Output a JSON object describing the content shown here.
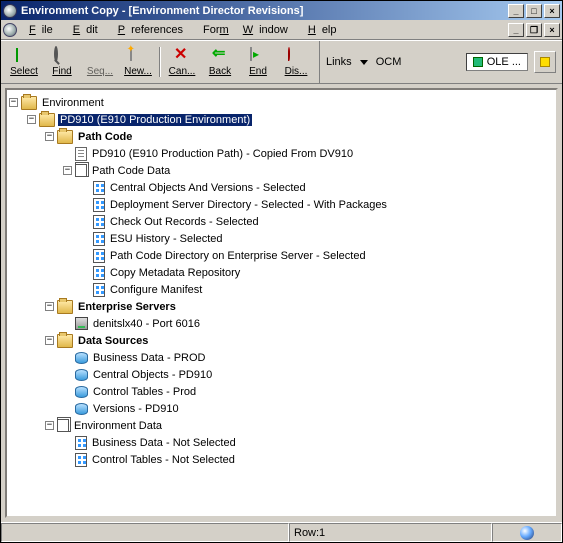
{
  "title": "Environment Copy - [Environment Director Revisions]",
  "menu": [
    "File",
    "Edit",
    "Preferences",
    "Form",
    "Window",
    "Help"
  ],
  "toolbar": {
    "select": "Select",
    "find": "Find",
    "seq": "Seq...",
    "new": "New...",
    "can": "Can...",
    "back": "Back",
    "end": "End",
    "dis": "Dis...",
    "links": "Links",
    "ocm": "OCM",
    "ole": "OLE ..."
  },
  "tree": {
    "root": "Environment",
    "env": {
      "label": "PD910 (E910 Production Environment)"
    },
    "pathcode": {
      "label": "Path Code",
      "copied": "PD910 (E910 Production Path) - Copied From DV910",
      "data": {
        "label": "Path Code Data",
        "items": [
          "Central Objects And Versions - Selected",
          "Deployment Server Directory - Selected - With Packages",
          "Check Out Records - Selected",
          "ESU History - Selected",
          "Path Code Directory on Enterprise Server - Selected",
          "Copy Metadata Repository",
          "Configure Manifest"
        ]
      }
    },
    "servers": {
      "label": "Enterprise Servers",
      "items": [
        "denitslx40 - Port 6016"
      ]
    },
    "datasources": {
      "label": "Data Sources",
      "items": [
        "Business Data - PROD",
        "Central Objects - PD910",
        "Control Tables - Prod",
        "Versions - PD910"
      ]
    },
    "envdata": {
      "label": "Environment Data",
      "items": [
        "Business Data - Not Selected",
        "Control Tables - Not Selected"
      ]
    }
  },
  "status": {
    "row": "Row:1"
  }
}
